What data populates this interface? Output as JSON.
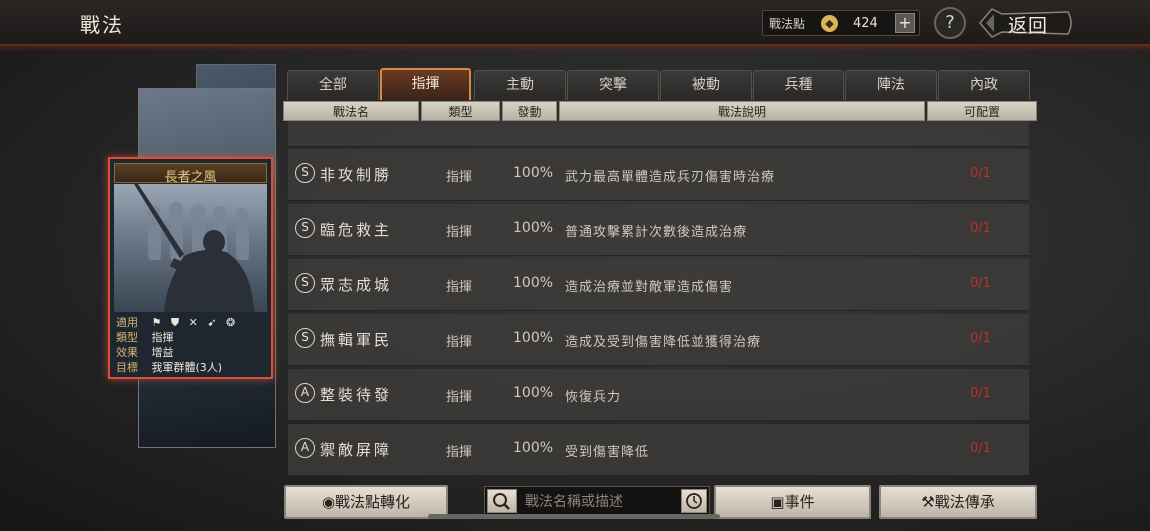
{
  "header": {
    "title": "戰法",
    "points_label": "戰法點",
    "points_value": "424",
    "plus_label": "+",
    "help_label": "?",
    "back_label": "返回"
  },
  "tabs": [
    {
      "label": "全部"
    },
    {
      "label": "指揮",
      "active": true
    },
    {
      "label": "主動"
    },
    {
      "label": "突擊"
    },
    {
      "label": "被動"
    },
    {
      "label": "兵種"
    },
    {
      "label": "陣法"
    },
    {
      "label": "內政"
    }
  ],
  "columns": {
    "name": "戰法名",
    "type": "類型",
    "rate": "發動",
    "desc": "戰法說明",
    "slot": "可配置"
  },
  "rows": [
    {
      "grade": "S",
      "name": "非攻制勝",
      "type": "指揮",
      "rate": "100%",
      "desc": "武力最高單體造成兵刃傷害時治療",
      "slot": "0/1"
    },
    {
      "grade": "S",
      "name": "臨危救主",
      "type": "指揮",
      "rate": "100%",
      "desc": "普通攻擊累計次數後造成治療",
      "slot": "0/1"
    },
    {
      "grade": "S",
      "name": "眾志成城",
      "type": "指揮",
      "rate": "100%",
      "desc": "造成治療並對敵軍造成傷害",
      "slot": "0/1"
    },
    {
      "grade": "S",
      "name": "撫輯軍民",
      "type": "指揮",
      "rate": "100%",
      "desc": "造成及受到傷害降低並獲得治療",
      "slot": "0/1"
    },
    {
      "grade": "A",
      "name": "整裝待發",
      "type": "指揮",
      "rate": "100%",
      "desc": "恢復兵力",
      "slot": "0/1"
    },
    {
      "grade": "A",
      "name": "禦敵屏障",
      "type": "指揮",
      "rate": "100%",
      "desc": "受到傷害降低",
      "slot": "0/1"
    }
  ],
  "card": {
    "title": "長者之風",
    "apply_label": "適用",
    "apply_icons": "⚑ ⛊ ✕ ➹ ❂",
    "type_label": "類型",
    "type_value": "指揮",
    "effect_label": "效果",
    "effect_value": "增益",
    "target_label": "目標",
    "target_value": "我軍群體(3人)"
  },
  "bottom": {
    "convert_label": "戰法點轉化",
    "search_placeholder": "戰法名稱或描述",
    "events_label": "事件",
    "inherit_label": "戰法傳承"
  },
  "colors": {
    "accent": "#d9884a",
    "slot_text": "#b8302a",
    "card_border": "#d8503a"
  }
}
